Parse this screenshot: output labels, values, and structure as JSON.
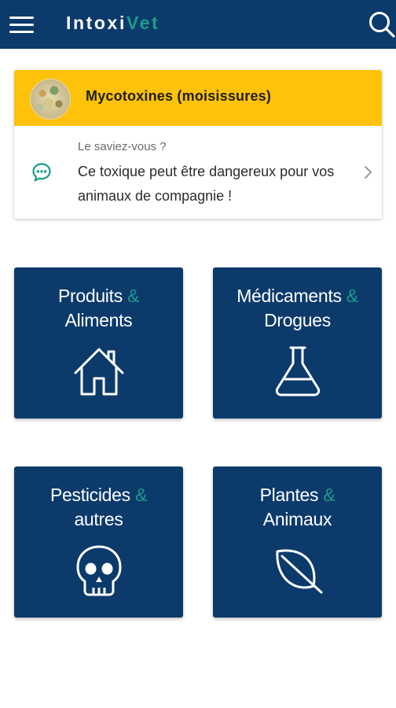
{
  "app": {
    "brand_part1": "Intoxi",
    "brand_part2": "Vet",
    "brand_color": "#1d9c89",
    "primary_color": "#0c3a6b"
  },
  "appbar": {
    "menu_icon": "hamburger-menu-icon",
    "search_icon": "search-icon"
  },
  "featured": {
    "title": "Mycotoxines (moisissures)",
    "tagline": "Le saviez-vous ?",
    "text": "Ce toxique peut être dangereux pour vos animaux de compagnie !",
    "header_color": "#fdc209",
    "icons": [
      "chat-bubble-icon",
      "chevron-right-icon"
    ]
  },
  "categories": [
    {
      "line1": "Produits",
      "amp": "&",
      "line2": "Aliments",
      "icon": "house-icon"
    },
    {
      "line1": "Médicaments",
      "amp": "&",
      "line2": "Drogues",
      "icon": "flask-icon"
    },
    {
      "line1": "Pesticides",
      "amp": "&",
      "line2": "autres",
      "icon": "skull-icon"
    },
    {
      "line1": "Plantes",
      "amp": "&",
      "line2": "Animaux",
      "icon": "leaf-icon"
    }
  ]
}
